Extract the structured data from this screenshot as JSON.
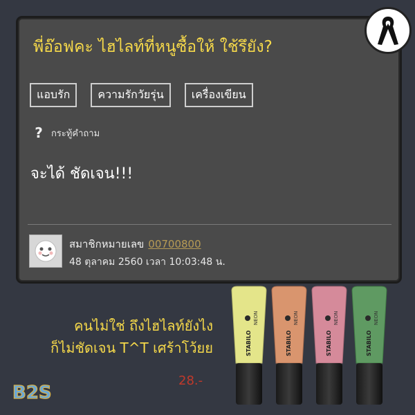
{
  "post": {
    "title": "พี่อ๊อฟคะ ไฮไลท์ที่หนูซื้อให้ ใช้รึยัง?",
    "tags": [
      "แอบรัก",
      "ความรักวัยรุ่น",
      "เครื่องเขียน"
    ],
    "type_label": "กระทู้คำถาม",
    "body": "จะได้ ชัดเจน!!!",
    "member_label": "สมาชิกหมายเลข",
    "member_id": "00700800",
    "date": "48 ตุลาคม 2560 เวลา 10:03:48 น."
  },
  "caption": {
    "line1": "คนไม่ใช่ ถึงไฮไลท์ยังไง",
    "line2": "ก็ไม่ชัดเจน T^T เศร้าโว้ยย"
  },
  "price": "28.-",
  "logo_text": "B2S",
  "product": {
    "brand": "STABILO",
    "line": "NEON",
    "colors": [
      "#e4e58a",
      "#d9956e",
      "#d58a9a",
      "#5f9a62"
    ]
  },
  "icons": {
    "badge": "black-ribbon-icon",
    "question": "question-mark-icon",
    "avatar": "smiley-avatar-icon"
  }
}
